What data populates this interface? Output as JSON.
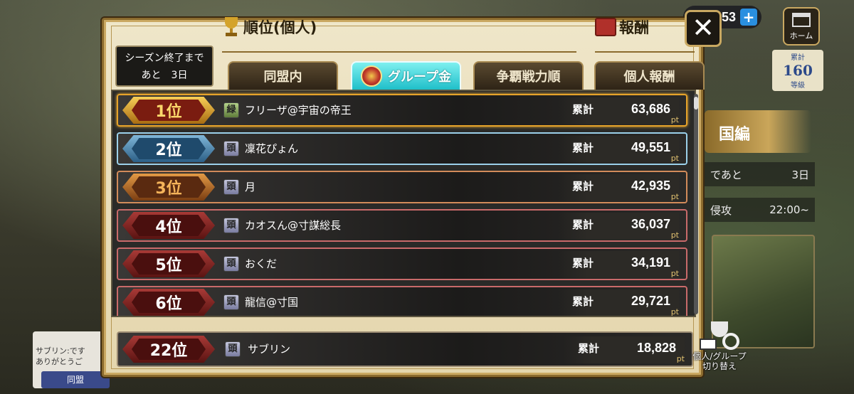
{
  "hud": {
    "currency_value": "53",
    "plus_label": "+",
    "home_label": "ホーム",
    "right_badge_top": "累計",
    "right_badge_value": "160",
    "right_badge_bottom": "等級"
  },
  "background": {
    "chapter_banner": "国編",
    "row1_left": "であと",
    "row1_right": "3日",
    "row2_left": "侵攻",
    "row2_right": "22:00~",
    "chat_text_1": "サブリン:です",
    "chat_text_2": "ありがとうご",
    "chat_tab_label": "同盟"
  },
  "panel": {
    "season_line1": "シーズン終了まで",
    "season_line2": "あと　3日",
    "ranking_title": "順位(個人)",
    "reward_title": "報酬",
    "close_label": "✕"
  },
  "tabs": [
    {
      "label": "同盟内",
      "active": false
    },
    {
      "label": "グループ金",
      "active": true
    },
    {
      "label": "争覇戦力順",
      "active": false
    },
    {
      "label": "個人報酬",
      "active": false
    }
  ],
  "rankings": [
    {
      "rank": "1位",
      "name": "フリーザ@宇宙の帝王",
      "icon": "緑",
      "total_label": "累計",
      "score": "63,686",
      "unit": "pt"
    },
    {
      "rank": "2位",
      "name": "凜花ぴょん",
      "icon": "頭",
      "total_label": "累計",
      "score": "49,551",
      "unit": "pt"
    },
    {
      "rank": "3位",
      "name": "月",
      "icon": "頭",
      "total_label": "累計",
      "score": "42,935",
      "unit": "pt"
    },
    {
      "rank": "4位",
      "name": "カオスん@寸謀総長",
      "icon": "頭",
      "total_label": "累計",
      "score": "36,037",
      "unit": "pt"
    },
    {
      "rank": "5位",
      "name": "おくだ",
      "icon": "頭",
      "total_label": "累計",
      "score": "34,191",
      "unit": "pt"
    },
    {
      "rank": "6位",
      "name": "龍信@寸国",
      "icon": "頭",
      "total_label": "累計",
      "score": "29,721",
      "unit": "pt"
    }
  ],
  "self": {
    "rank": "22位",
    "name": "サブリン",
    "icon": "頭",
    "total_label": "累計",
    "score": "18,828",
    "unit": "pt"
  },
  "switch": {
    "line1": "個人/グループ",
    "line2": "切り替え"
  },
  "colors": {
    "gold": "#e6a32a",
    "silver": "#9bd0ea",
    "bronze": "#d28b5a",
    "red": "#c96a6a",
    "active_tab": "#1fbfc9"
  }
}
